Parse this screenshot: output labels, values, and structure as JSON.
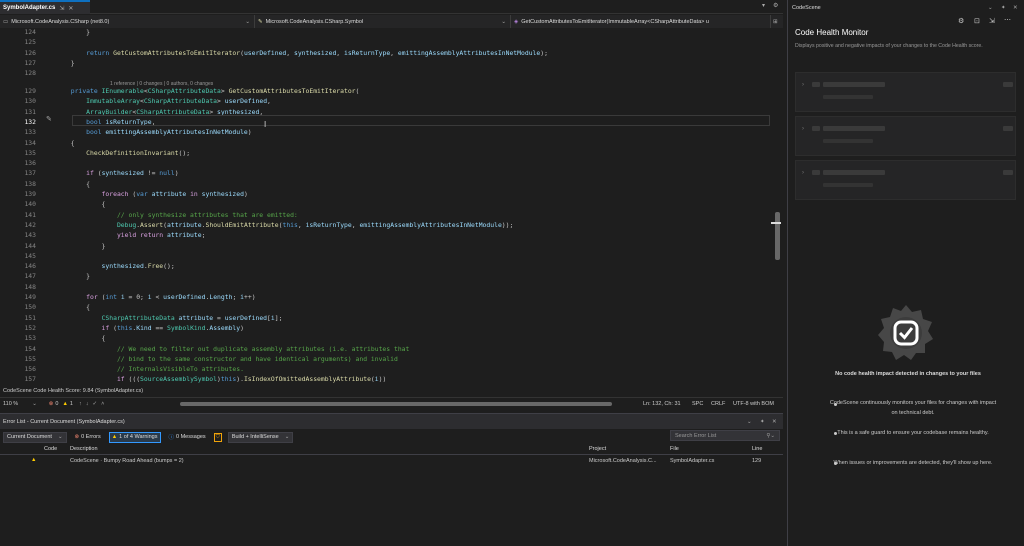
{
  "editor": {
    "tab": {
      "title": "SymbolAdapter.cs",
      "pin": "⇲",
      "close": "✕"
    },
    "tab_overflow": "▾",
    "tab_settings": "⚙",
    "nav": {
      "project": "Microsoft.CodeAnalysis.CSharp (net8.0)",
      "type": "Microsoft.CodeAnalysis.CSharp.Symbol",
      "member": "GetCustomAttributesToEmitIterator(ImmutableArray<CSharpAttributeData> u"
    },
    "codelens": "1 reference | 0 changes | 0 authors, 0 changes",
    "lines": [
      {
        "n": "124",
        "segs": [
          [
            "tb",
            "            }"
          ]
        ]
      },
      {
        "n": "125",
        "segs": []
      },
      {
        "n": "126",
        "segs": [
          [
            "kw",
            "            return "
          ],
          [
            "mt",
            "GetCustomAttributesToEmitIterator"
          ],
          [
            "tb",
            "("
          ],
          [
            "id",
            "userDefined"
          ],
          [
            "tb",
            ", "
          ],
          [
            "id",
            "synthesized"
          ],
          [
            "tb",
            ", "
          ],
          [
            "id",
            "isReturnType"
          ],
          [
            "tb",
            ", "
          ],
          [
            "id",
            "emittingAssemblyAttributesInNetModule"
          ],
          [
            "tb",
            ");"
          ]
        ]
      },
      {
        "n": "127",
        "segs": [
          [
            "tb",
            "        }"
          ]
        ]
      },
      {
        "n": "128",
        "segs": []
      },
      {
        "n": "129",
        "segs": [
          [
            "kw",
            "        private "
          ],
          [
            "ty",
            "IEnumerable"
          ],
          [
            "tb",
            "<"
          ],
          [
            "ty",
            "CSharpAttributeData"
          ],
          [
            "tb",
            "> "
          ],
          [
            "mt",
            "GetCustomAttributesToEmitIterator"
          ],
          [
            "tb",
            "("
          ]
        ]
      },
      {
        "n": "130",
        "segs": [
          [
            "ty",
            "            ImmutableArray"
          ],
          [
            "tb",
            "<"
          ],
          [
            "ty",
            "CSharpAttributeData"
          ],
          [
            "tb",
            "> "
          ],
          [
            "id",
            "userDefined"
          ],
          [
            "tb",
            ","
          ]
        ]
      },
      {
        "n": "131",
        "segs": [
          [
            "ty",
            "            ArrayBuilder"
          ],
          [
            "tb",
            "<"
          ],
          [
            "ty",
            "CSharpAttributeData"
          ],
          [
            "tb",
            "> "
          ],
          [
            "id",
            "synthesized"
          ],
          [
            "tb",
            ","
          ]
        ]
      },
      {
        "n": "132",
        "cur": true,
        "segs": [
          [
            "kw",
            "            bool "
          ],
          [
            "id",
            "isReturnType"
          ],
          [
            "tb",
            ","
          ]
        ]
      },
      {
        "n": "133",
        "segs": [
          [
            "kw",
            "            bool "
          ],
          [
            "id",
            "emittingAssemblyAttributesInNetModule"
          ],
          [
            "tb",
            ")"
          ]
        ]
      },
      {
        "n": "134",
        "segs": [
          [
            "tb",
            "        {"
          ]
        ]
      },
      {
        "n": "135",
        "segs": [
          [
            "mt",
            "            CheckDefinitionInvariant"
          ],
          [
            "tb",
            "();"
          ]
        ]
      },
      {
        "n": "136",
        "segs": []
      },
      {
        "n": "137",
        "segs": [
          [
            "ctl",
            "            if "
          ],
          [
            "tb",
            "("
          ],
          [
            "id",
            "synthesized"
          ],
          [
            "tb",
            " != "
          ],
          [
            "kw",
            "null"
          ],
          [
            "tb",
            ")"
          ]
        ]
      },
      {
        "n": "138",
        "segs": [
          [
            "tb",
            "            {"
          ]
        ]
      },
      {
        "n": "139",
        "segs": [
          [
            "ctl",
            "                foreach "
          ],
          [
            "tb",
            "("
          ],
          [
            "kw",
            "var "
          ],
          [
            "id",
            "attribute"
          ],
          [
            "ctl",
            " in "
          ],
          [
            "id",
            "synthesized"
          ],
          [
            "tb",
            ")"
          ]
        ]
      },
      {
        "n": "140",
        "segs": [
          [
            "tb",
            "                {"
          ]
        ]
      },
      {
        "n": "141",
        "segs": [
          [
            "cm",
            "                    // only synthesize attributes that are emitted:"
          ]
        ]
      },
      {
        "n": "142",
        "segs": [
          [
            "ty",
            "                    Debug"
          ],
          [
            "tb",
            "."
          ],
          [
            "mt",
            "Assert"
          ],
          [
            "tb",
            "("
          ],
          [
            "id",
            "attribute"
          ],
          [
            "tb",
            "."
          ],
          [
            "mt",
            "ShouldEmitAttribute"
          ],
          [
            "tb",
            "("
          ],
          [
            "kw",
            "this"
          ],
          [
            "tb",
            ", "
          ],
          [
            "id",
            "isReturnType"
          ],
          [
            "tb",
            ", "
          ],
          [
            "id",
            "emittingAssemblyAttributesInNetModule"
          ],
          [
            "tb",
            "));"
          ]
        ]
      },
      {
        "n": "143",
        "segs": [
          [
            "ctl",
            "                    yield return "
          ],
          [
            "id",
            "attribute"
          ],
          [
            "tb",
            ";"
          ]
        ]
      },
      {
        "n": "144",
        "segs": [
          [
            "tb",
            "                }"
          ]
        ]
      },
      {
        "n": "145",
        "segs": []
      },
      {
        "n": "146",
        "segs": [
          [
            "id",
            "                synthesized"
          ],
          [
            "tb",
            "."
          ],
          [
            "mt",
            "Free"
          ],
          [
            "tb",
            "();"
          ]
        ]
      },
      {
        "n": "147",
        "segs": [
          [
            "tb",
            "            }"
          ]
        ]
      },
      {
        "n": "148",
        "segs": []
      },
      {
        "n": "149",
        "segs": [
          [
            "ctl",
            "            for "
          ],
          [
            "tb",
            "("
          ],
          [
            "kw",
            "int "
          ],
          [
            "id",
            "i"
          ],
          [
            "tb",
            " = 0; "
          ],
          [
            "id",
            "i"
          ],
          [
            "tb",
            " < "
          ],
          [
            "id",
            "userDefined"
          ],
          [
            "tb",
            "."
          ],
          [
            "id",
            "Length"
          ],
          [
            "tb",
            "; "
          ],
          [
            "id",
            "i"
          ],
          [
            "tb",
            "++)"
          ]
        ]
      },
      {
        "n": "150",
        "segs": [
          [
            "tb",
            "            {"
          ]
        ]
      },
      {
        "n": "151",
        "segs": [
          [
            "ty",
            "                CSharpAttributeData "
          ],
          [
            "id",
            "attribute"
          ],
          [
            "tb",
            " = "
          ],
          [
            "id",
            "userDefined"
          ],
          [
            "tb",
            "["
          ],
          [
            "id",
            "i"
          ],
          [
            "tb",
            "];"
          ]
        ]
      },
      {
        "n": "152",
        "segs": [
          [
            "ctl",
            "                if "
          ],
          [
            "tb",
            "("
          ],
          [
            "kw",
            "this"
          ],
          [
            "tb",
            "."
          ],
          [
            "id",
            "Kind"
          ],
          [
            "tb",
            " == "
          ],
          [
            "ty",
            "SymbolKind"
          ],
          [
            "tb",
            "."
          ],
          [
            "id",
            "Assembly"
          ],
          [
            "tb",
            ")"
          ]
        ]
      },
      {
        "n": "153",
        "segs": [
          [
            "tb",
            "                {"
          ]
        ]
      },
      {
        "n": "154",
        "segs": [
          [
            "cm",
            "                    // We need to filter out duplicate assembly attributes (i.e. attributes that"
          ]
        ]
      },
      {
        "n": "155",
        "segs": [
          [
            "cm",
            "                    // bind to the same constructor and have identical arguments) and invalid"
          ]
        ]
      },
      {
        "n": "156",
        "segs": [
          [
            "cm",
            "                    // InternalsVisibleTo attributes."
          ]
        ]
      },
      {
        "n": "157",
        "segs": [
          [
            "ctl",
            "                    if "
          ],
          [
            "tb",
            "((("
          ],
          [
            "ty",
            "SourceAssemblySymbol"
          ],
          [
            "tb",
            ")"
          ],
          [
            "kw",
            "this"
          ],
          [
            "tb",
            ")."
          ],
          [
            "mt",
            "IsIndexOfOmittedAssemblyAttribute"
          ],
          [
            "tb",
            "("
          ],
          [
            "id",
            "i"
          ],
          [
            "tb",
            "))"
          ]
        ]
      }
    ],
    "health_score": "CodeScene Code Health Score: 9.84 (SymbolAdapter.cs)",
    "zoom": "110 %",
    "errors_count": "0",
    "warnings_count": "1",
    "position": "Ln: 132, Ch: 31",
    "indent": "SPC",
    "eol": "CRLF",
    "encoding": "UTF-8 with BOM"
  },
  "error_list": {
    "title": "Error List - Current Document (SymbolAdapter.cs)",
    "scope": "Current Document",
    "errors": "0 Errors",
    "warnings": "1 of 4 Warnings",
    "messages": "0 Messages",
    "build": "Build + IntelliSense",
    "search_placeholder": "Search Error List",
    "headers": {
      "code": "Code",
      "description": "Description",
      "project": "Project",
      "file": "File",
      "line": "Line"
    },
    "rows": [
      {
        "description": "CodeScene · Bumpy Road Ahead (bumps = 2)",
        "project": "Microsoft.CodeAnalysis.C...",
        "file": "SymbolAdapter.cs",
        "line": "129"
      }
    ]
  },
  "codescene": {
    "title": "CodeScene",
    "heading": "Code Health Monitor",
    "description": "Displays positive and negative impacts of your changes to the Code Health score.",
    "message": "No code health impact detected in changes to your files",
    "bullets": [
      "CodeScene continuously monitors your files for changes with impact on technical debt.",
      "This is a safe guard to ensure your codebase remains healthy.",
      "When issues or improvements are detected, they'll show up here."
    ]
  }
}
